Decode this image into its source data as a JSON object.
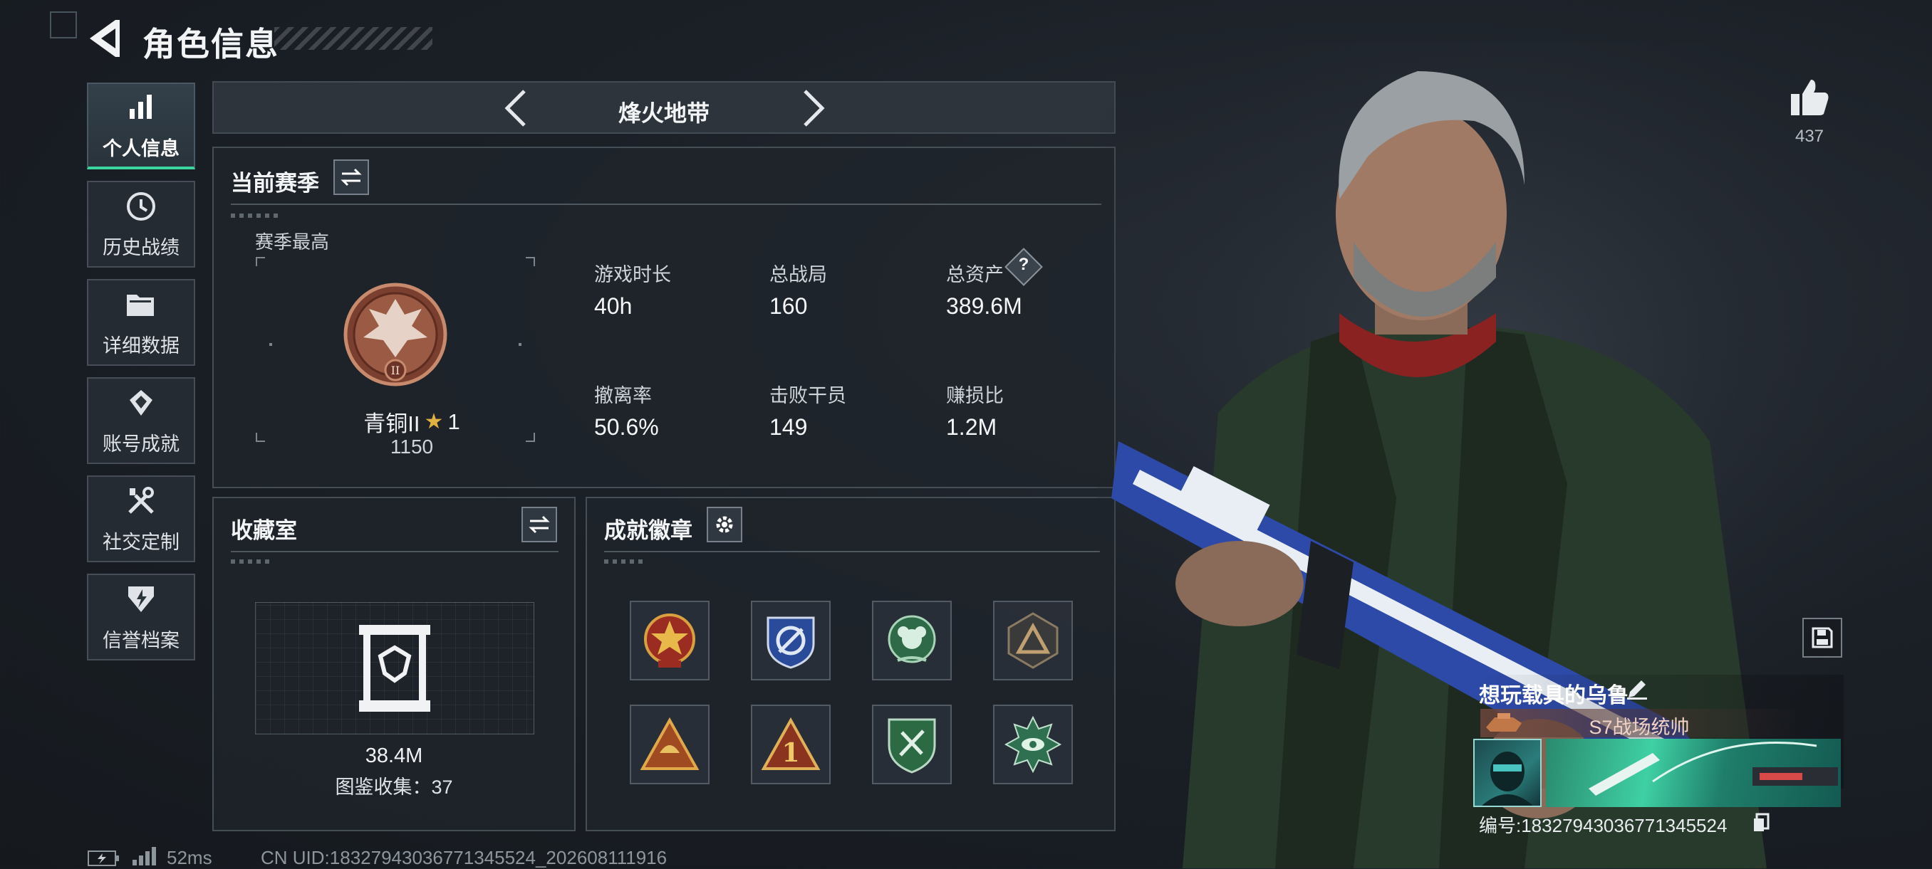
{
  "header": {
    "title": "角色信息"
  },
  "sidebar": {
    "items": [
      {
        "label": "个人信息",
        "icon": "bar-chart-icon",
        "active": true
      },
      {
        "label": "历史战绩",
        "icon": "history-icon",
        "active": false
      },
      {
        "label": "详细数据",
        "icon": "folder-icon",
        "active": false
      },
      {
        "label": "账号成就",
        "icon": "achievement-icon",
        "active": false
      },
      {
        "label": "社交定制",
        "icon": "tools-icon",
        "active": false
      },
      {
        "label": "信誉档案",
        "icon": "reputation-icon",
        "active": false
      }
    ]
  },
  "map_selector": {
    "current": "烽火地带"
  },
  "season": {
    "title": "当前赛季",
    "best_label": "赛季最高",
    "rank_name": "青铜II",
    "rank_stars": "1",
    "rank_score": "1150",
    "stats": [
      {
        "label": "游戏时长",
        "value": "40h"
      },
      {
        "label": "总战局",
        "value": "160"
      },
      {
        "label": "总资产",
        "value": "389.6M",
        "help": "?"
      },
      {
        "label": "撤离率",
        "value": "50.6%"
      },
      {
        "label": "击败干员",
        "value": "149"
      },
      {
        "label": "赚损比",
        "value": "1.2M"
      }
    ]
  },
  "collection": {
    "title": "收藏室",
    "value": "38.4M",
    "gallery_label": "图鉴收集：37"
  },
  "badges": {
    "title": "成就徽章",
    "items": [
      "red-star-badge-icon",
      "blue-arrows-badge-icon",
      "green-flower-badge-icon",
      "dark-triangle-badge-icon",
      "gold-triangle-badge-icon",
      "number-one-badge-icon",
      "green-shield-badge-icon",
      "green-eye-badge-icon"
    ]
  },
  "profile": {
    "likes": "437",
    "player_name": "想玩载具的乌鲁",
    "title_badge": "S7战场统帅",
    "id_line": "编号:18327943036771345524"
  },
  "footer": {
    "ping": "52ms",
    "uid": "CN UID:18327943036771345524_202608111916"
  },
  "colors": {
    "accent": "#3ad6a0",
    "panel_border": "#6e7882",
    "bronze": "#9a5a44"
  }
}
